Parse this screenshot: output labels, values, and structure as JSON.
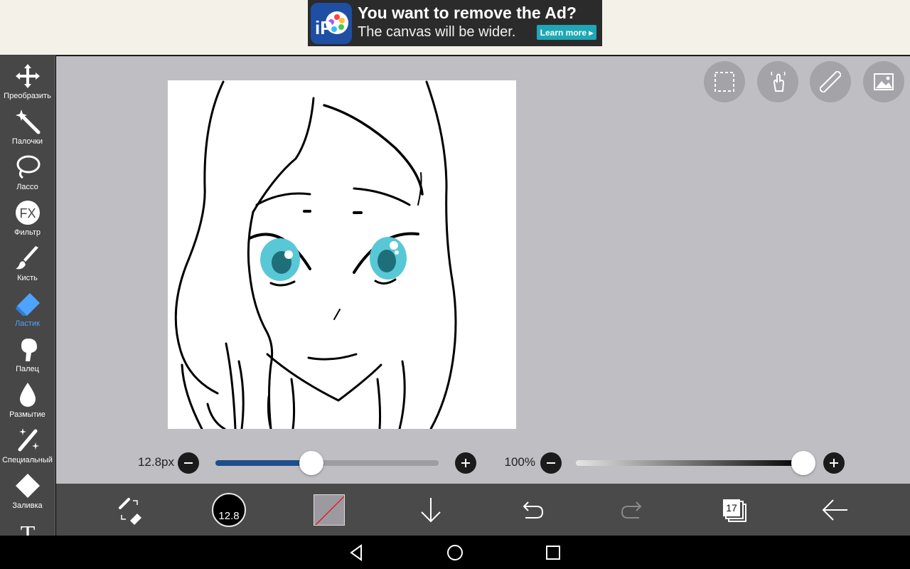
{
  "ad": {
    "title": "You want to remove the Ad?",
    "subtitle": "The canvas will be wider.",
    "button": "Learn more ▸",
    "logo_text": "iP"
  },
  "tools": [
    {
      "label": "Преобразить",
      "icon": "move-icon"
    },
    {
      "label": "Палочки",
      "icon": "magic-wand-icon"
    },
    {
      "label": "Лассо",
      "icon": "lasso-icon"
    },
    {
      "label": "Фильтр",
      "icon": "fx-icon",
      "icon_text": "FX"
    },
    {
      "label": "Кисть",
      "icon": "brush-icon"
    },
    {
      "label": "Ластик",
      "icon": "eraser-icon",
      "active": true
    },
    {
      "label": "Палец",
      "icon": "finger-smudge-icon"
    },
    {
      "label": "Размытие",
      "icon": "blur-drop-icon"
    },
    {
      "label": "Специальный",
      "icon": "special-brush-icon"
    },
    {
      "label": "Заливка",
      "icon": "fill-bucket-icon"
    },
    {
      "label": "",
      "icon": "text-icon",
      "icon_text": "T"
    }
  ],
  "top_right": [
    "selection-icon",
    "hand-gesture-icon",
    "ruler-icon",
    "image-import-icon"
  ],
  "brush": {
    "size_label": "12.8px",
    "size_fraction": 0.43
  },
  "opacity": {
    "label": "100%",
    "fraction": 1.0
  },
  "bottom": {
    "brush_size_value": "12.8",
    "layer_count": "17"
  },
  "colors": {
    "accent": "#4da3ff",
    "slider_fill": "#1f4e8c",
    "toolbar_bg": "#474747",
    "workspace_bg": "#bfbec3"
  }
}
